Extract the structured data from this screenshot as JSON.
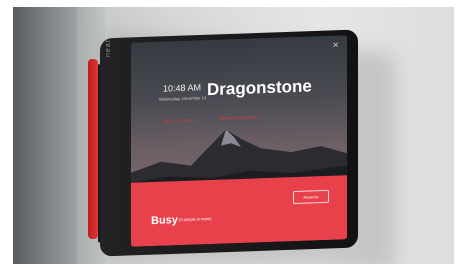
{
  "device": {
    "brand": "neat."
  },
  "screen": {
    "time": "10:48 AM",
    "date": "Wednesday, December 13",
    "room_name": "Dragonstone",
    "close_icon": "close-icon",
    "next_event_time": "11:00 - 11:30 AM",
    "next_event_title": "Weekly Sync Meeting",
    "status": {
      "label": "Busy",
      "subtext": "(5 people in room)",
      "color": "#e8414b"
    },
    "reserve_label": "Reserve"
  }
}
